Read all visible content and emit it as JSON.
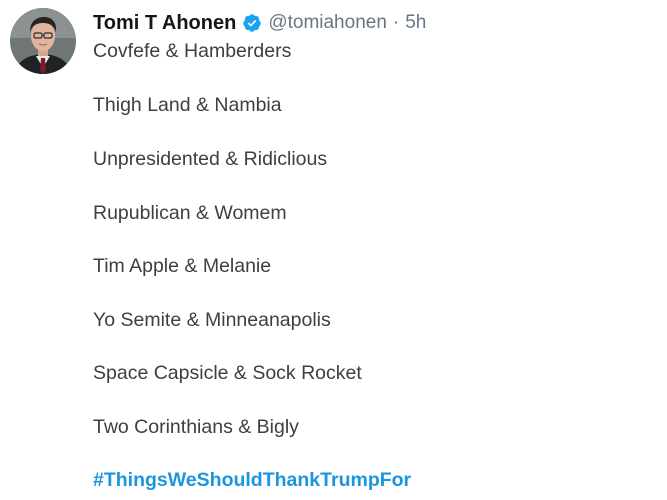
{
  "tweet": {
    "author": {
      "name": "Tomi T Ahonen",
      "handle": "@tomiahonen",
      "separator": "·",
      "time": "5h",
      "verified_icon": "verified-badge-icon",
      "verified_color": "#1da1f2"
    },
    "lines": [
      "Covfefe & Hamberders",
      "Thigh Land & Nambia",
      "Unpresidented & Ridiclious",
      "Rupublican & Womem",
      "Tim Apple & Melanie",
      "Yo Semite & Minneanapolis",
      "Space Capsicle & Sock Rocket",
      "Two Corinthians & Bigly"
    ],
    "hashtag": "#ThingsWeShouldThankTrumpFor",
    "hashtag_color": "#1b95e0"
  }
}
